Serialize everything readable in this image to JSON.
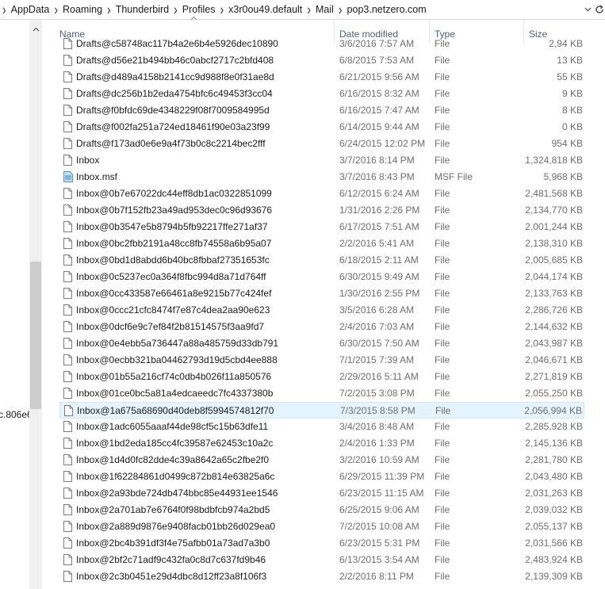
{
  "breadcrumb": [
    "AppData",
    "Roaming",
    "Thunderbird",
    "Profiles",
    "x3r0ou49.default",
    "Mail",
    "pop3.netzero.com"
  ],
  "nav_pane": {
    "partial_text": "c.806e6"
  },
  "columns": {
    "name": "Name",
    "date": "Date modified",
    "type": "Type",
    "size": "Size"
  },
  "icons": {
    "file": "file-icon",
    "msf": "msf-file-icon",
    "refresh": "refresh-icon",
    "dropdown": "chevron-down-icon",
    "scroll_up": "scroll-up-arrow-icon",
    "sort": "sort-ascending-icon"
  },
  "colors": {
    "header_text": "#4c607a",
    "selected_bg": "#e5f3ff",
    "selected_border": "#cde8ff",
    "meta_text": "#6d6d6d"
  },
  "files": [
    {
      "name": "Drafts@c58748ac117b4a2e6b4e5926dec10890",
      "date": "3/6/2016 7:57 AM",
      "type": "File",
      "size": "2,94 KB",
      "icon": "file"
    },
    {
      "name": "Drafts@d56e21b494bb46c0abcf2717c2bfd408",
      "date": "6/8/2015 7:53 AM",
      "type": "File",
      "size": "13 KB",
      "icon": "file"
    },
    {
      "name": "Drafts@d489a4158b2141cc9d988f8e0f31ae8d",
      "date": "6/21/2015 9:56 AM",
      "type": "File",
      "size": "55 KB",
      "icon": "file"
    },
    {
      "name": "Drafts@dc256b1b2eda4754bfc6c49453f3cc04",
      "date": "6/16/2015 8:32 AM",
      "type": "File",
      "size": "9 KB",
      "icon": "file"
    },
    {
      "name": "Drafts@f0bfdc69de4348229f08f7009584995d",
      "date": "6/16/2015 7:47 AM",
      "type": "File",
      "size": "8 KB",
      "icon": "file"
    },
    {
      "name": "Drafts@f002fa251a724ed18461f90e03a23f99",
      "date": "6/14/2015 9:44 AM",
      "type": "File",
      "size": "0 KB",
      "icon": "file"
    },
    {
      "name": "Drafts@f173ad0e6e9a4f73b0c8c2214bec2fff",
      "date": "6/24/2015 12:02 PM",
      "type": "File",
      "size": "954 KB",
      "icon": "file"
    },
    {
      "name": "Inbox",
      "date": "3/7/2016 8:14 PM",
      "type": "File",
      "size": "1,324,818 KB",
      "icon": "file"
    },
    {
      "name": "Inbox.msf",
      "date": "3/7/2016 8:43 PM",
      "type": "MSF File",
      "size": "5,968 KB",
      "icon": "msf"
    },
    {
      "name": "Inbox@0b7e67022dc44eff8db1ac0322851099",
      "date": "6/12/2015 6:24 AM",
      "type": "File",
      "size": "2,481,568 KB",
      "icon": "file"
    },
    {
      "name": "Inbox@0b7f152fb23a49ad953dec0c96d93676",
      "date": "1/31/2016 2:26 PM",
      "type": "File",
      "size": "2,134,770 KB",
      "icon": "file"
    },
    {
      "name": "Inbox@0b3547e5b8794b5fb92217ffe271af37",
      "date": "6/17/2015 7:51 AM",
      "type": "File",
      "size": "2,001,244 KB",
      "icon": "file"
    },
    {
      "name": "Inbox@0bc2fbb2191a48cc8fb74558a6b95a07",
      "date": "2/2/2016 5:41 AM",
      "type": "File",
      "size": "2,138,310 KB",
      "icon": "file"
    },
    {
      "name": "Inbox@0bd1d8abdd6b40bc8fbbaf27351653fc",
      "date": "6/18/2015 2:11 AM",
      "type": "File",
      "size": "2,005,685 KB",
      "icon": "file"
    },
    {
      "name": "Inbox@0c5237ec0a364f8fbc994d8a71d764ff",
      "date": "6/30/2015 9:49 AM",
      "type": "File",
      "size": "2,044,174 KB",
      "icon": "file"
    },
    {
      "name": "Inbox@0cc433587e66461a8e9215b77c424fef",
      "date": "1/30/2016 2:55 PM",
      "type": "File",
      "size": "2,133,763 KB",
      "icon": "file"
    },
    {
      "name": "Inbox@0ccc21cfc8474f7e87c4dea2aa90e623",
      "date": "3/5/2016 6:28 AM",
      "type": "File",
      "size": "2,286,726 KB",
      "icon": "file"
    },
    {
      "name": "Inbox@0dcf6e9c7ef84f2b81514575f3aa9fd7",
      "date": "2/4/2016 7:03 AM",
      "type": "File",
      "size": "2,144,632 KB",
      "icon": "file"
    },
    {
      "name": "Inbox@0e4ebb5a736447a88a485759d33db791",
      "date": "6/30/2015 7:50 AM",
      "type": "File",
      "size": "2,043,987 KB",
      "icon": "file"
    },
    {
      "name": "Inbox@0ecbb321ba04462793d19d5cbd4ee888",
      "date": "7/1/2015 7:39 AM",
      "type": "File",
      "size": "2,046,671 KB",
      "icon": "file"
    },
    {
      "name": "Inbox@01b55a216cf74c0db4b026f11a850576",
      "date": "2/29/2016 5:11 AM",
      "type": "File",
      "size": "2,271,819 KB",
      "icon": "file"
    },
    {
      "name": "Inbox@01ce0bc5a81a4edcaeedc7fc4337380b",
      "date": "7/2/2015 3:08 PM",
      "type": "File",
      "size": "2,055,250 KB",
      "icon": "file"
    },
    {
      "name": "Inbox@1a675a68690d40deb8f5994574812f70",
      "date": "7/3/2015 8:58 PM",
      "type": "File",
      "size": "2,056,994 KB",
      "icon": "file",
      "selected": true
    },
    {
      "name": "Inbox@1adc6055aaaf44de98cf5c15b63dfe11",
      "date": "3/4/2016 8:48 AM",
      "type": "File",
      "size": "2,285,928 KB",
      "icon": "file"
    },
    {
      "name": "Inbox@1bd2eda185cc4fc39587e62453c10a2c",
      "date": "2/4/2016 1:33 PM",
      "type": "File",
      "size": "2,145,136 KB",
      "icon": "file"
    },
    {
      "name": "Inbox@1d4d0fc82dde4c39a8642a65c2fbe2f0",
      "date": "3/2/2016 10:59 AM",
      "type": "File",
      "size": "2,281,780 KB",
      "icon": "file"
    },
    {
      "name": "Inbox@1f62284861d0499c872b814e63825a6c",
      "date": "6/29/2015 11:39 PM",
      "type": "File",
      "size": "2,043,480 KB",
      "icon": "file"
    },
    {
      "name": "Inbox@2a93bde724db474bbc85e44931ee1546",
      "date": "6/23/2015 11:15 AM",
      "type": "File",
      "size": "2,031,263 KB",
      "icon": "file"
    },
    {
      "name": "Inbox@2a701ab7e6764f0f98bdbfcb974a2bd5",
      "date": "6/25/2015 9:06 AM",
      "type": "File",
      "size": "2,039,032 KB",
      "icon": "file"
    },
    {
      "name": "Inbox@2a889d9876e9408facb01bb26d029ea0",
      "date": "7/2/2015 10:08 AM",
      "type": "File",
      "size": "2,055,137 KB",
      "icon": "file"
    },
    {
      "name": "Inbox@2bc4b391df3f4e75afbb01a73ad7a3b0",
      "date": "6/23/2015 5:31 PM",
      "type": "File",
      "size": "2,031,566 KB",
      "icon": "file"
    },
    {
      "name": "Inbox@2bf2c71adf9c432fa0c8d7c637fd9b46",
      "date": "6/13/2015 3:54 AM",
      "type": "File",
      "size": "2,483,924 KB",
      "icon": "file"
    },
    {
      "name": "Inbox@2c3b0451e29d4dbc8d12ff23a8f106f3",
      "date": "2/2/2016 8:11 PM",
      "type": "File",
      "size": "2,139,309 KB",
      "icon": "file"
    }
  ]
}
